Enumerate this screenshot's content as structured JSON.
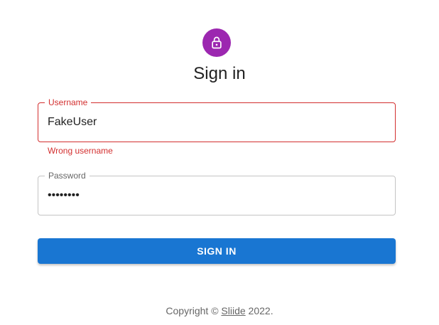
{
  "header": {
    "icon": "lock-icon",
    "title": "Sign in"
  },
  "form": {
    "username": {
      "label": "Username",
      "value": "FakeUser",
      "error": "Wrong username"
    },
    "password": {
      "label": "Password",
      "value": "••••••••"
    },
    "submit_label": "SIGN IN"
  },
  "footer": {
    "copyright": "Copyright ©",
    "link_text": "Sliide",
    "year_text": "2022."
  },
  "colors": {
    "avatar": "#9c27b0",
    "primary": "#1976d2",
    "error": "#d32f2f"
  }
}
